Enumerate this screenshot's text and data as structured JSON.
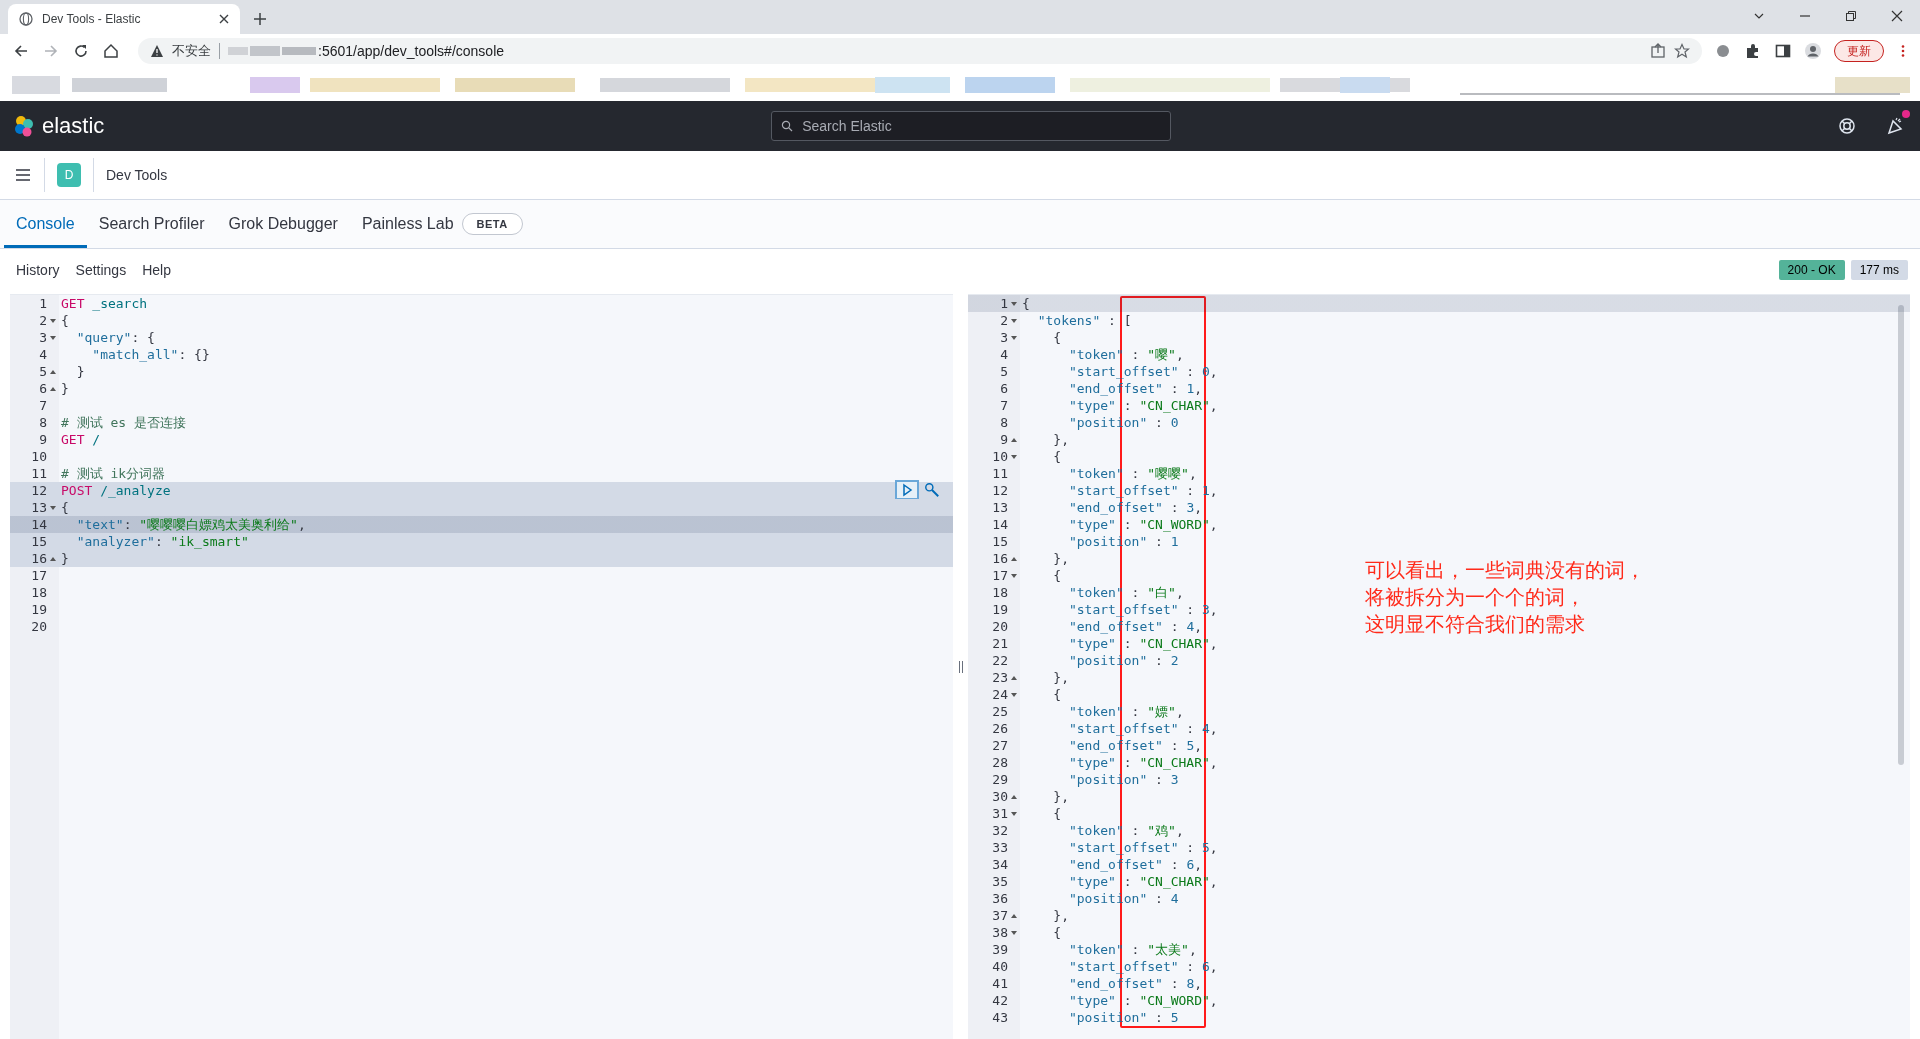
{
  "browser": {
    "tab": {
      "title": "Dev Tools - Elastic"
    },
    "address": {
      "security": "不安全",
      "url": ":5601/app/dev_tools#/console"
    },
    "update_button": "更新"
  },
  "header": {
    "logo": "elastic",
    "search": {
      "placeholder": "Search Elastic"
    },
    "has_news": true
  },
  "breadcrumb": {
    "avatar": "D",
    "title": "Dev Tools"
  },
  "tabs": [
    {
      "label": "Console",
      "selected": true
    },
    {
      "label": "Search Profiler",
      "selected": false
    },
    {
      "label": "Grok Debugger",
      "selected": false
    },
    {
      "label": "Painless Lab",
      "selected": false,
      "badge": "BETA"
    }
  ],
  "toolbar": [
    "History",
    "Settings",
    "Help"
  ],
  "status": {
    "code": "200 - OK",
    "time": "177 ms"
  },
  "request": {
    "lines": [
      {
        "n": "1",
        "kind": "plain",
        "in_request": false,
        "cursor": false,
        "tokens": [
          {
            "text": "GET",
            "kind": "method"
          },
          {
            "text": " _search",
            "kind": "path"
          }
        ]
      },
      {
        "n": "2",
        "kind": "fold-start",
        "in_request": false,
        "cursor": false,
        "tokens": [
          {
            "text": "{",
            "kind": "punct"
          }
        ]
      },
      {
        "n": "3",
        "kind": "fold-start",
        "in_request": false,
        "cursor": false,
        "tokens": [
          {
            "text": "  \"query\"",
            "kind": "key"
          },
          {
            "text": ": {",
            "kind": "punct"
          }
        ]
      },
      {
        "n": "4",
        "kind": "plain",
        "in_request": false,
        "cursor": false,
        "tokens": [
          {
            "text": "    \"match_all\"",
            "kind": "key"
          },
          {
            "text": ": {}",
            "kind": "punct"
          }
        ]
      },
      {
        "n": "5",
        "kind": "fold-end",
        "in_request": false,
        "cursor": false,
        "tokens": [
          {
            "text": "  }",
            "kind": "punct"
          }
        ]
      },
      {
        "n": "6",
        "kind": "fold-end",
        "in_request": false,
        "cursor": false,
        "tokens": [
          {
            "text": "}",
            "kind": "punct"
          }
        ]
      },
      {
        "n": "7",
        "kind": "plain",
        "in_request": false,
        "cursor": false
      },
      {
        "n": "8",
        "kind": "plain",
        "in_request": false,
        "cursor": false,
        "tokens": [
          {
            "text": "# 测试 es 是否连接",
            "kind": "comment"
          }
        ]
      },
      {
        "n": "9",
        "kind": "plain",
        "in_request": false,
        "cursor": false,
        "tokens": [
          {
            "text": "GET",
            "kind": "method"
          },
          {
            "text": " /",
            "kind": "path"
          }
        ]
      },
      {
        "n": "10",
        "kind": "plain",
        "in_request": false,
        "cursor": false
      },
      {
        "n": "11",
        "kind": "plain",
        "in_request": false,
        "cursor": false,
        "tokens": [
          {
            "text": "# 测试 ik分词器",
            "kind": "comment"
          }
        ]
      },
      {
        "n": "12",
        "kind": "plain",
        "in_request": true,
        "cursor": false,
        "tokens": [
          {
            "text": "POST",
            "kind": "method"
          },
          {
            "text": " /_analyze",
            "kind": "path"
          }
        ]
      },
      {
        "n": "13",
        "kind": "fold-start",
        "in_request": true,
        "cursor": false,
        "tokens": [
          {
            "text": "{",
            "kind": "punct"
          }
        ]
      },
      {
        "n": "14",
        "kind": "plain",
        "in_request": true,
        "cursor": true,
        "tokens": [
          {
            "text": "  \"text\"",
            "kind": "key"
          },
          {
            "text": ": ",
            "kind": "punct"
          },
          {
            "text": "\"嘤嘤嘤白嫖鸡太美奥利给\"",
            "kind": "string"
          },
          {
            "text": ",",
            "kind": "punct"
          }
        ]
      },
      {
        "n": "15",
        "kind": "plain",
        "in_request": true,
        "cursor": false,
        "tokens": [
          {
            "text": "  \"analyzer\"",
            "kind": "key"
          },
          {
            "text": ": ",
            "kind": "punct"
          },
          {
            "text": "\"ik_smart\"",
            "kind": "string"
          }
        ]
      },
      {
        "n": "16",
        "kind": "fold-end",
        "in_request": true,
        "cursor": false,
        "tokens": [
          {
            "text": "}",
            "kind": "punct"
          }
        ]
      },
      {
        "n": "17",
        "kind": "plain",
        "in_request": false,
        "cursor": false
      },
      {
        "n": "18",
        "kind": "plain",
        "in_request": false,
        "cursor": false
      },
      {
        "n": "19",
        "kind": "plain",
        "in_request": false,
        "cursor": false
      },
      {
        "n": "20",
        "kind": "plain",
        "in_request": false,
        "cursor": false
      }
    ]
  },
  "response": {
    "lines": [
      {
        "n": "1",
        "kind": "fold-start",
        "cursor": true,
        "tokens": [
          {
            "text": "{",
            "kind": "punct"
          }
        ]
      },
      {
        "n": "2",
        "kind": "fold-start",
        "cursor": false,
        "tokens": [
          {
            "text": "  \"tokens\"",
            "kind": "key"
          },
          {
            "text": " : [",
            "kind": "punct"
          }
        ]
      },
      {
        "n": "3",
        "kind": "fold-start",
        "cursor": false,
        "tokens": [
          {
            "text": "    {",
            "kind": "punct"
          }
        ]
      },
      {
        "n": "4",
        "kind": "plain",
        "cursor": false,
        "tokens": [
          {
            "text": "      \"token\"",
            "kind": "key"
          },
          {
            "text": " : ",
            "kind": "punct"
          },
          {
            "text": "\"嘤\"",
            "kind": "string"
          },
          {
            "text": ",",
            "kind": "punct"
          }
        ]
      },
      {
        "n": "5",
        "kind": "plain",
        "cursor": false,
        "tokens": [
          {
            "text": "      \"start_offset\"",
            "kind": "key"
          },
          {
            "text": " : ",
            "kind": "punct"
          },
          {
            "text": "0",
            "kind": "number"
          },
          {
            "text": ",",
            "kind": "punct"
          }
        ]
      },
      {
        "n": "6",
        "kind": "plain",
        "cursor": false,
        "tokens": [
          {
            "text": "      \"end_offset\"",
            "kind": "key"
          },
          {
            "text": " : ",
            "kind": "punct"
          },
          {
            "text": "1",
            "kind": "number"
          },
          {
            "text": ",",
            "kind": "punct"
          }
        ]
      },
      {
        "n": "7",
        "kind": "plain",
        "cursor": false,
        "tokens": [
          {
            "text": "      \"type\"",
            "kind": "key"
          },
          {
            "text": " : ",
            "kind": "punct"
          },
          {
            "text": "\"CN_CHAR\"",
            "kind": "string"
          },
          {
            "text": ",",
            "kind": "punct"
          }
        ]
      },
      {
        "n": "8",
        "kind": "plain",
        "cursor": false,
        "tokens": [
          {
            "text": "      \"position\"",
            "kind": "key"
          },
          {
            "text": " : ",
            "kind": "punct"
          },
          {
            "text": "0",
            "kind": "number"
          }
        ]
      },
      {
        "n": "9",
        "kind": "fold-end",
        "cursor": false,
        "tokens": [
          {
            "text": "    },",
            "kind": "punct"
          }
        ]
      },
      {
        "n": "10",
        "kind": "fold-start",
        "cursor": false,
        "tokens": [
          {
            "text": "    {",
            "kind": "punct"
          }
        ]
      },
      {
        "n": "11",
        "kind": "plain",
        "cursor": false,
        "tokens": [
          {
            "text": "      \"token\"",
            "kind": "key"
          },
          {
            "text": " : ",
            "kind": "punct"
          },
          {
            "text": "\"嘤嘤\"",
            "kind": "string"
          },
          {
            "text": ",",
            "kind": "punct"
          }
        ]
      },
      {
        "n": "12",
        "kind": "plain",
        "cursor": false,
        "tokens": [
          {
            "text": "      \"start_offset\"",
            "kind": "key"
          },
          {
            "text": " : ",
            "kind": "punct"
          },
          {
            "text": "1",
            "kind": "number"
          },
          {
            "text": ",",
            "kind": "punct"
          }
        ]
      },
      {
        "n": "13",
        "kind": "plain",
        "cursor": false,
        "tokens": [
          {
            "text": "      \"end_offset\"",
            "kind": "key"
          },
          {
            "text": " : ",
            "kind": "punct"
          },
          {
            "text": "3",
            "kind": "number"
          },
          {
            "text": ",",
            "kind": "punct"
          }
        ]
      },
      {
        "n": "14",
        "kind": "plain",
        "cursor": false,
        "tokens": [
          {
            "text": "      \"type\"",
            "kind": "key"
          },
          {
            "text": " : ",
            "kind": "punct"
          },
          {
            "text": "\"CN_WORD\"",
            "kind": "string"
          },
          {
            "text": ",",
            "kind": "punct"
          }
        ]
      },
      {
        "n": "15",
        "kind": "plain",
        "cursor": false,
        "tokens": [
          {
            "text": "      \"position\"",
            "kind": "key"
          },
          {
            "text": " : ",
            "kind": "punct"
          },
          {
            "text": "1",
            "kind": "number"
          }
        ]
      },
      {
        "n": "16",
        "kind": "fold-end",
        "cursor": false,
        "tokens": [
          {
            "text": "    },",
            "kind": "punct"
          }
        ]
      },
      {
        "n": "17",
        "kind": "fold-start",
        "cursor": false,
        "tokens": [
          {
            "text": "    {",
            "kind": "punct"
          }
        ]
      },
      {
        "n": "18",
        "kind": "plain",
        "cursor": false,
        "tokens": [
          {
            "text": "      \"token\"",
            "kind": "key"
          },
          {
            "text": " : ",
            "kind": "punct"
          },
          {
            "text": "\"白\"",
            "kind": "string"
          },
          {
            "text": ",",
            "kind": "punct"
          }
        ]
      },
      {
        "n": "19",
        "kind": "plain",
        "cursor": false,
        "tokens": [
          {
            "text": "      \"start_offset\"",
            "kind": "key"
          },
          {
            "text": " : ",
            "kind": "punct"
          },
          {
            "text": "3",
            "kind": "number"
          },
          {
            "text": ",",
            "kind": "punct"
          }
        ]
      },
      {
        "n": "20",
        "kind": "plain",
        "cursor": false,
        "tokens": [
          {
            "text": "      \"end_offset\"",
            "kind": "key"
          },
          {
            "text": " : ",
            "kind": "punct"
          },
          {
            "text": "4",
            "kind": "number"
          },
          {
            "text": ",",
            "kind": "punct"
          }
        ]
      },
      {
        "n": "21",
        "kind": "plain",
        "cursor": false,
        "tokens": [
          {
            "text": "      \"type\"",
            "kind": "key"
          },
          {
            "text": " : ",
            "kind": "punct"
          },
          {
            "text": "\"CN_CHAR\"",
            "kind": "string"
          },
          {
            "text": ",",
            "kind": "punct"
          }
        ]
      },
      {
        "n": "22",
        "kind": "plain",
        "cursor": false,
        "tokens": [
          {
            "text": "      \"position\"",
            "kind": "key"
          },
          {
            "text": " : ",
            "kind": "punct"
          },
          {
            "text": "2",
            "kind": "number"
          }
        ]
      },
      {
        "n": "23",
        "kind": "fold-end",
        "cursor": false,
        "tokens": [
          {
            "text": "    },",
            "kind": "punct"
          }
        ]
      },
      {
        "n": "24",
        "kind": "fold-start",
        "cursor": false,
        "tokens": [
          {
            "text": "    {",
            "kind": "punct"
          }
        ]
      },
      {
        "n": "25",
        "kind": "plain",
        "cursor": false,
        "tokens": [
          {
            "text": "      \"token\"",
            "kind": "key"
          },
          {
            "text": " : ",
            "kind": "punct"
          },
          {
            "text": "\"嫖\"",
            "kind": "string"
          },
          {
            "text": ",",
            "kind": "punct"
          }
        ]
      },
      {
        "n": "26",
        "kind": "plain",
        "cursor": false,
        "tokens": [
          {
            "text": "      \"start_offset\"",
            "kind": "key"
          },
          {
            "text": " : ",
            "kind": "punct"
          },
          {
            "text": "4",
            "kind": "number"
          },
          {
            "text": ",",
            "kind": "punct"
          }
        ]
      },
      {
        "n": "27",
        "kind": "plain",
        "cursor": false,
        "tokens": [
          {
            "text": "      \"end_offset\"",
            "kind": "key"
          },
          {
            "text": " : ",
            "kind": "punct"
          },
          {
            "text": "5",
            "kind": "number"
          },
          {
            "text": ",",
            "kind": "punct"
          }
        ]
      },
      {
        "n": "28",
        "kind": "plain",
        "cursor": false,
        "tokens": [
          {
            "text": "      \"type\"",
            "kind": "key"
          },
          {
            "text": " : ",
            "kind": "punct"
          },
          {
            "text": "\"CN_CHAR\"",
            "kind": "string"
          },
          {
            "text": ",",
            "kind": "punct"
          }
        ]
      },
      {
        "n": "29",
        "kind": "plain",
        "cursor": false,
        "tokens": [
          {
            "text": "      \"position\"",
            "kind": "key"
          },
          {
            "text": " : ",
            "kind": "punct"
          },
          {
            "text": "3",
            "kind": "number"
          }
        ]
      },
      {
        "n": "30",
        "kind": "fold-end",
        "cursor": false,
        "tokens": [
          {
            "text": "    },",
            "kind": "punct"
          }
        ]
      },
      {
        "n": "31",
        "kind": "fold-start",
        "cursor": false,
        "tokens": [
          {
            "text": "    {",
            "kind": "punct"
          }
        ]
      },
      {
        "n": "32",
        "kind": "plain",
        "cursor": false,
        "tokens": [
          {
            "text": "      \"token\"",
            "kind": "key"
          },
          {
            "text": " : ",
            "kind": "punct"
          },
          {
            "text": "\"鸡\"",
            "kind": "string"
          },
          {
            "text": ",",
            "kind": "punct"
          }
        ]
      },
      {
        "n": "33",
        "kind": "plain",
        "cursor": false,
        "tokens": [
          {
            "text": "      \"start_offset\"",
            "kind": "key"
          },
          {
            "text": " : ",
            "kind": "punct"
          },
          {
            "text": "5",
            "kind": "number"
          },
          {
            "text": ",",
            "kind": "punct"
          }
        ]
      },
      {
        "n": "34",
        "kind": "plain",
        "cursor": false,
        "tokens": [
          {
            "text": "      \"end_offset\"",
            "kind": "key"
          },
          {
            "text": " : ",
            "kind": "punct"
          },
          {
            "text": "6",
            "kind": "number"
          },
          {
            "text": ",",
            "kind": "punct"
          }
        ]
      },
      {
        "n": "35",
        "kind": "plain",
        "cursor": false,
        "tokens": [
          {
            "text": "      \"type\"",
            "kind": "key"
          },
          {
            "text": " : ",
            "kind": "punct"
          },
          {
            "text": "\"CN_CHAR\"",
            "kind": "string"
          },
          {
            "text": ",",
            "kind": "punct"
          }
        ]
      },
      {
        "n": "36",
        "kind": "plain",
        "cursor": false,
        "tokens": [
          {
            "text": "      \"position\"",
            "kind": "key"
          },
          {
            "text": " : ",
            "kind": "punct"
          },
          {
            "text": "4",
            "kind": "number"
          }
        ]
      },
      {
        "n": "37",
        "kind": "fold-end",
        "cursor": false,
        "tokens": [
          {
            "text": "    },",
            "kind": "punct"
          }
        ]
      },
      {
        "n": "38",
        "kind": "fold-start",
        "cursor": false,
        "tokens": [
          {
            "text": "    {",
            "kind": "punct"
          }
        ]
      },
      {
        "n": "39",
        "kind": "plain",
        "cursor": false,
        "tokens": [
          {
            "text": "      \"token\"",
            "kind": "key"
          },
          {
            "text": " : ",
            "kind": "punct"
          },
          {
            "text": "\"太美\"",
            "kind": "string"
          },
          {
            "text": ",",
            "kind": "punct"
          }
        ]
      },
      {
        "n": "40",
        "kind": "plain",
        "cursor": false,
        "tokens": [
          {
            "text": "      \"start_offset\"",
            "kind": "key"
          },
          {
            "text": " : ",
            "kind": "punct"
          },
          {
            "text": "6",
            "kind": "number"
          },
          {
            "text": ",",
            "kind": "punct"
          }
        ]
      },
      {
        "n": "41",
        "kind": "plain",
        "cursor": false,
        "tokens": [
          {
            "text": "      \"end_offset\"",
            "kind": "key"
          },
          {
            "text": " : ",
            "kind": "punct"
          },
          {
            "text": "8",
            "kind": "number"
          },
          {
            "text": ",",
            "kind": "punct"
          }
        ]
      },
      {
        "n": "42",
        "kind": "plain",
        "cursor": false,
        "tokens": [
          {
            "text": "      \"type\"",
            "kind": "key"
          },
          {
            "text": " : ",
            "kind": "punct"
          },
          {
            "text": "\"CN_WORD\"",
            "kind": "string"
          },
          {
            "text": ",",
            "kind": "punct"
          }
        ]
      },
      {
        "n": "43",
        "kind": "plain",
        "cursor": false,
        "tokens": [
          {
            "text": "      \"position\"",
            "kind": "key"
          },
          {
            "text": " : ",
            "kind": "punct"
          },
          {
            "text": "5",
            "kind": "number"
          }
        ]
      }
    ]
  },
  "annotation": {
    "lines": [
      "可以看出，一些词典没有的词，",
      "将被拆分为一个个的词，",
      "这明显不符合我们的需求"
    ]
  }
}
